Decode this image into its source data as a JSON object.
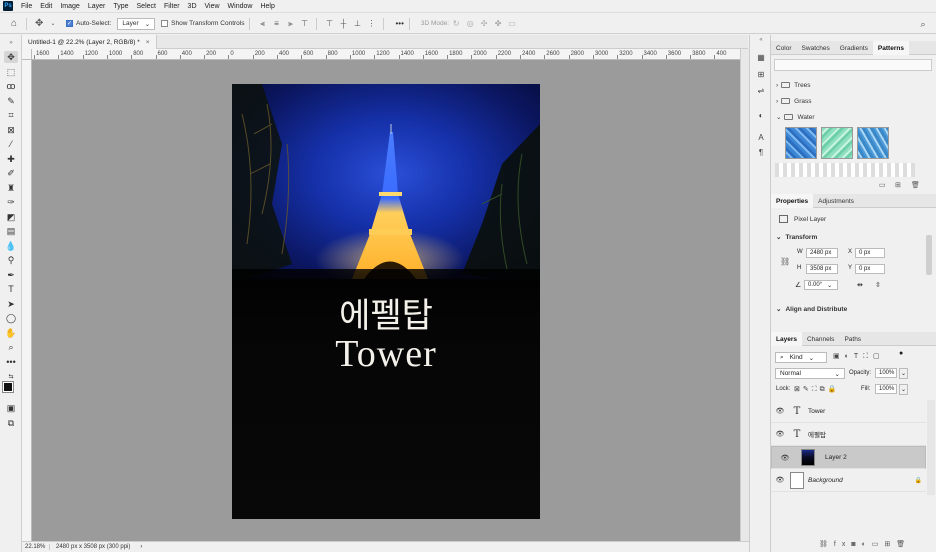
{
  "app": {
    "logo": "Ps"
  },
  "menu": [
    "File",
    "Edit",
    "Image",
    "Layer",
    "Type",
    "Select",
    "Filter",
    "3D",
    "View",
    "Window",
    "Help"
  ],
  "options": {
    "auto_select_label": "Auto-Select:",
    "auto_select_value": "Layer",
    "show_transform_label": "Show Transform Controls",
    "more": "•••",
    "mode_label": "3D Mode:"
  },
  "document_tab": {
    "title": "Untitled-1 @ 22.2% (Layer 2, RGB/8) *",
    "close": "×"
  },
  "ruler_labels": [
    "1600",
    "1400",
    "1200",
    "1000",
    "800",
    "600",
    "400",
    "200",
    "0",
    "200",
    "400",
    "600",
    "800",
    "1000",
    "1200",
    "1400",
    "1600",
    "1800",
    "2000",
    "2200",
    "2400",
    "2600",
    "2800",
    "3000",
    "3200",
    "3400",
    "3600",
    "3800",
    "400"
  ],
  "canvas": {
    "korean_text": "에펠탑",
    "english_text": "Tower"
  },
  "status": {
    "zoom": "22.18%",
    "info": "2480 px x 3508 px (300 ppi)",
    "arrow": "›"
  },
  "top_panel": {
    "tabs": [
      "Color",
      "Swatches",
      "Gradients",
      "Patterns"
    ],
    "active_tab": "Patterns",
    "groups": [
      "Trees",
      "Grass",
      "Water"
    ]
  },
  "properties": {
    "tabs": [
      "Properties",
      "Adjustments"
    ],
    "layer_kind": "Pixel Layer",
    "transform_title": "Transform",
    "w_label": "W",
    "w_value": "2480 px",
    "h_label": "H",
    "h_value": "3508 px",
    "x_label": "X",
    "x_value": "0 px",
    "y_label": "Y",
    "y_value": "0 px",
    "angle_value": "0.00°",
    "align_title": "Align and Distribute"
  },
  "layers_panel": {
    "tabs": [
      "Layers",
      "Channels",
      "Paths"
    ],
    "kind": "Kind",
    "blend": "Normal",
    "opacity_label": "Opacity:",
    "opacity": "100%",
    "lock_label": "Lock:",
    "fill_label": "Fill:",
    "fill": "100%",
    "layers": [
      {
        "name": "Tower",
        "type": "text"
      },
      {
        "name": "에펠탑",
        "type": "text"
      },
      {
        "name": "Layer 2",
        "type": "pixel",
        "selected": true
      },
      {
        "name": "Background",
        "type": "background"
      }
    ],
    "footer_fx": "fx"
  }
}
